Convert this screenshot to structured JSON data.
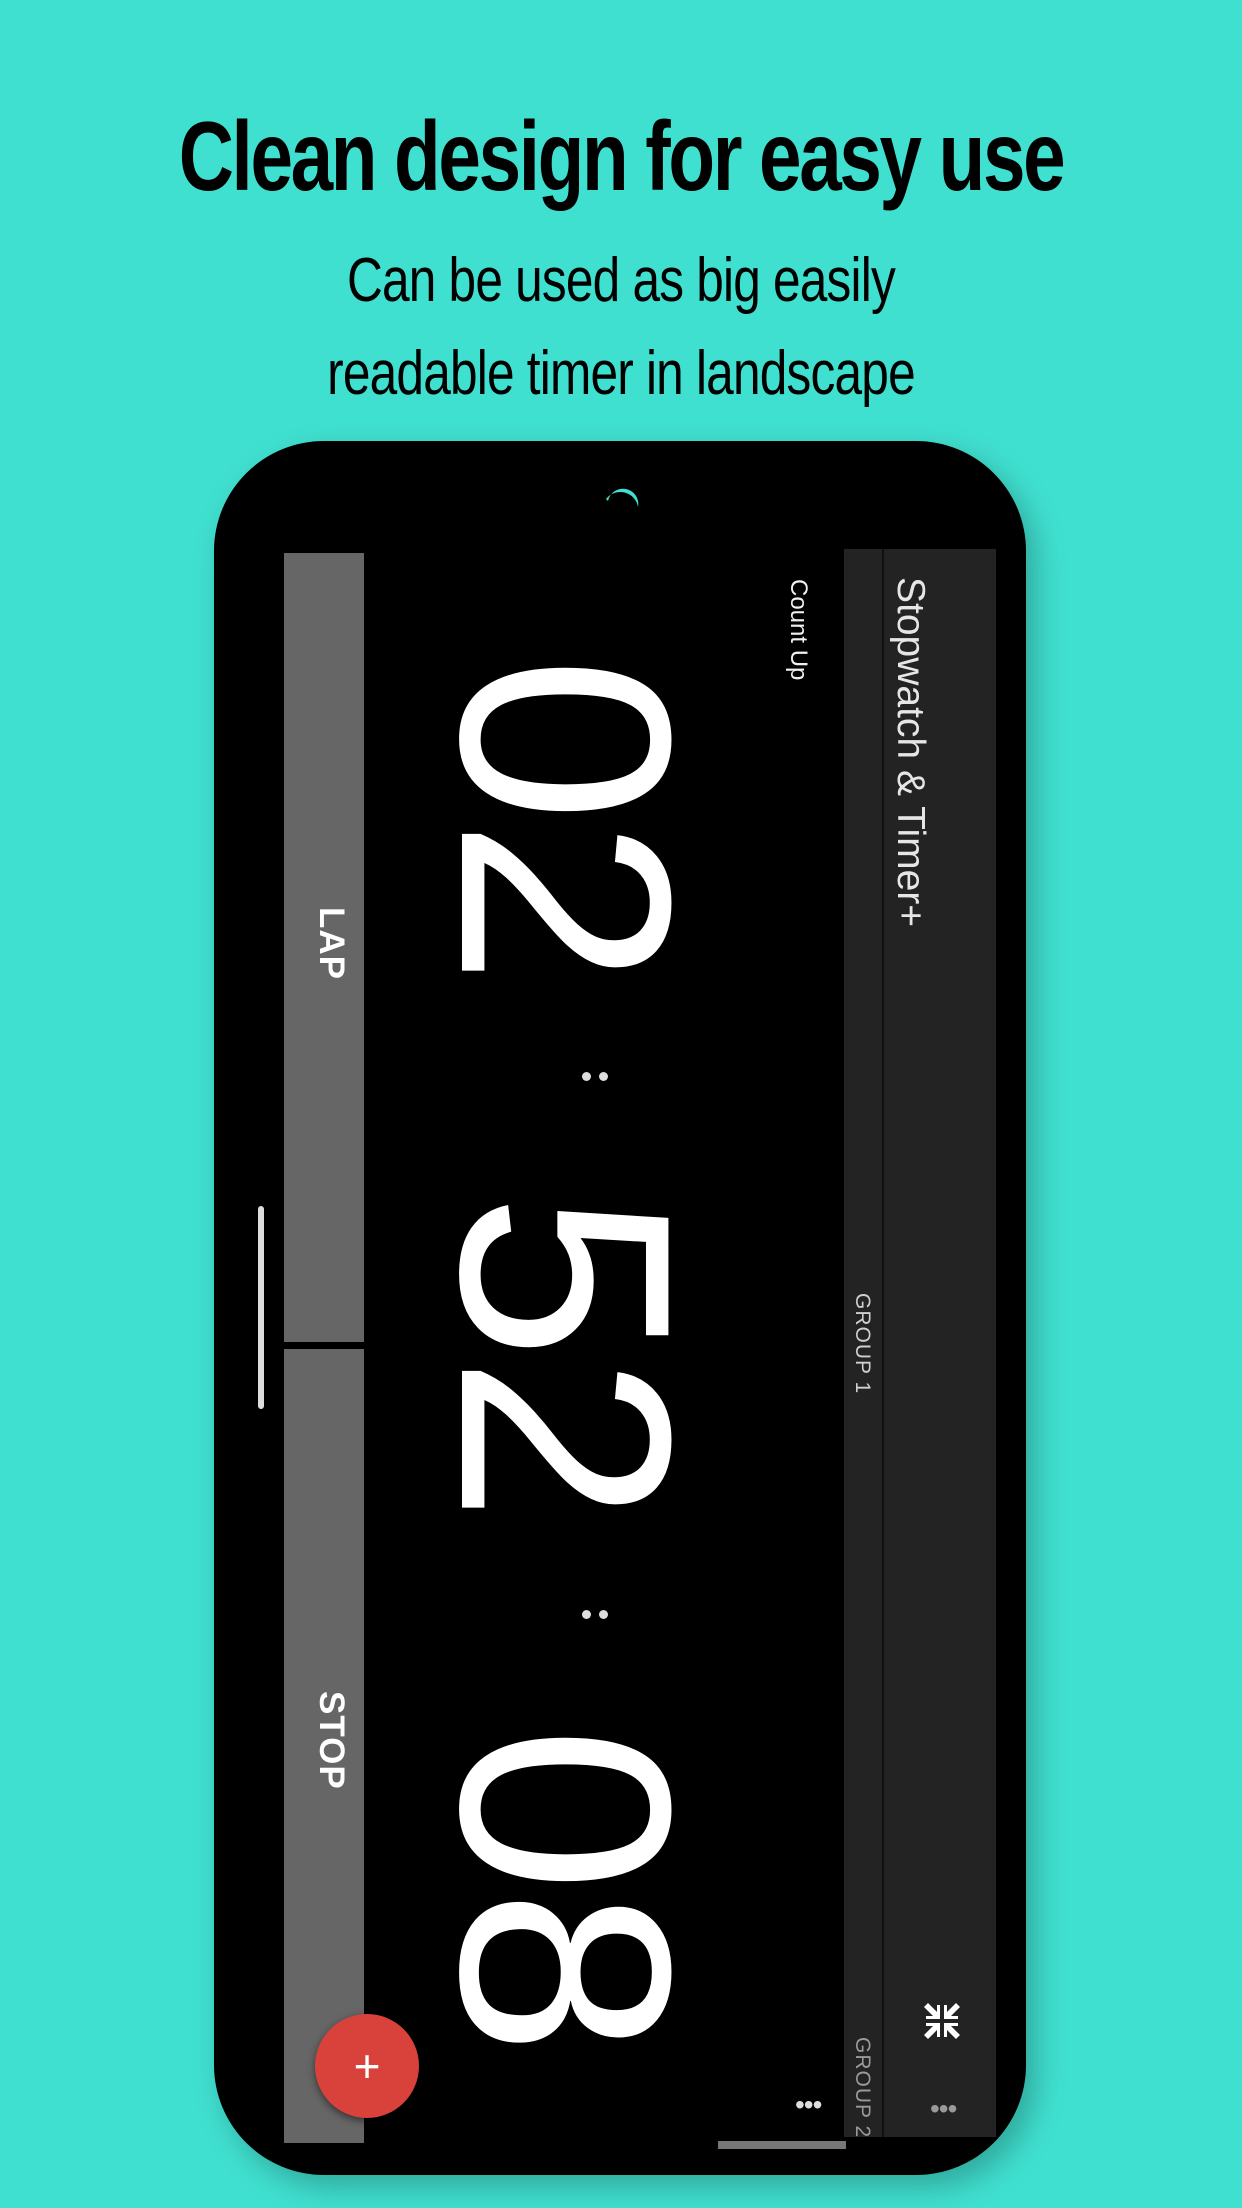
{
  "headline": "Clean design for easy use",
  "subheadline": {
    "line1": "Can be used as big easily",
    "line2": "readable timer in landscape"
  },
  "app": {
    "title": "Stopwatch & Timer+",
    "mode": "Count Up",
    "tabs": [
      "GROUP 1",
      "GROUP 2"
    ],
    "time": {
      "hours": "02",
      "minutes": "52",
      "seconds": "08"
    },
    "buttons": {
      "lap": "LAP",
      "stop": "STOP"
    },
    "fab": "+",
    "more": "•••",
    "icons": {
      "collapse": "collapse-icon",
      "add": "plus-icon",
      "more": "more-icon"
    },
    "colors": {
      "background": "#40e0d0",
      "fab": "#d9423b",
      "button": "#666666",
      "appbar": "#232323"
    }
  }
}
